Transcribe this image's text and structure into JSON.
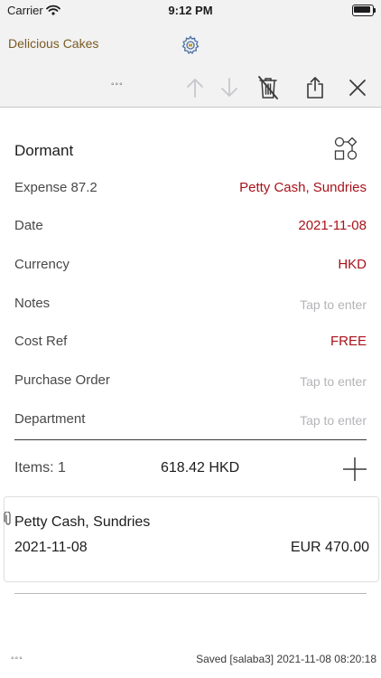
{
  "status_bar": {
    "carrier": "Carrier",
    "time": "9:12 PM"
  },
  "header": {
    "app_title": "Delicious Cakes",
    "more_label": "◦◦◦"
  },
  "record": {
    "status": "Dormant",
    "fields": [
      {
        "label": "Expense 87.2",
        "value": "Petty Cash, Sundries",
        "placeholder": false
      },
      {
        "label": "Date",
        "value": "2021-11-08",
        "placeholder": false
      },
      {
        "label": "Currency",
        "value": "HKD",
        "placeholder": false
      },
      {
        "label": "Notes",
        "value": "Tap to enter",
        "placeholder": true
      },
      {
        "label": "Cost Ref",
        "value": "FREE",
        "placeholder": false
      },
      {
        "label": "Purchase Order",
        "value": "Tap to enter",
        "placeholder": true
      },
      {
        "label": "Department",
        "value": "Tap to enter",
        "placeholder": true
      }
    ]
  },
  "items": {
    "label": "Items: 1",
    "total": "618.42  HKD",
    "list": [
      {
        "account": "Petty Cash, Sundries",
        "date": "2021-11-08",
        "amount": "EUR 470.00"
      }
    ]
  },
  "footer": {
    "more_label": "◦◦◦",
    "status": "Saved [salaba3] 2021-11-08 08:20:18"
  },
  "colors": {
    "accent_red": "#a8121a",
    "title_brown": "#7a5a22",
    "bar_bg": "#f2f2f2"
  }
}
